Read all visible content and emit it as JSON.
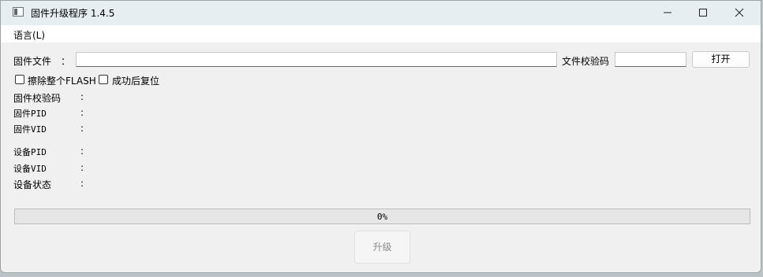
{
  "window": {
    "title": "固件升级程序 1.4.5"
  },
  "menubar": {
    "language": "语言(L)"
  },
  "form": {
    "firmware_file_label": "固件文件",
    "colon": "：",
    "firmware_file_value": "",
    "file_checksum_label": "文件校验码",
    "file_checksum_value": "",
    "open_button": "打开",
    "erase_flash_label": "擦除整个FLASH",
    "erase_flash_checked": false,
    "reset_after_success_label": "成功后复位",
    "reset_after_success_checked": false
  },
  "info": {
    "firmware_checksum_label": "固件校验码",
    "firmware_pid_label": "固件PID",
    "firmware_vid_label": "固件VID",
    "device_pid_label": "设备PID",
    "device_vid_label": "设备VID",
    "device_status_label": "设备状态",
    "colon": ":"
  },
  "progress": {
    "value": 0,
    "text": "0%"
  },
  "actions": {
    "upgrade_button": "升级"
  }
}
